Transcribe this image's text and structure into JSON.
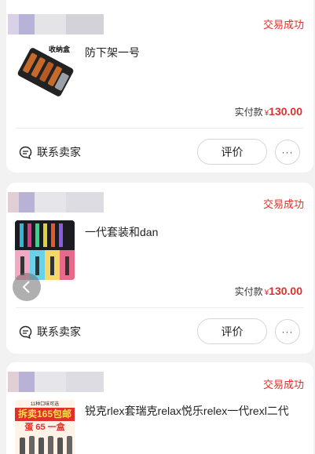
{
  "orders": [
    {
      "status": "交易成功",
      "thumb_badge": "收纳盒",
      "title": "防下架一号",
      "pay_label": "实付款",
      "currency": "¥",
      "amount": "130.00",
      "contact_label": "联系卖家",
      "review_label": "评价",
      "more_label": "···"
    },
    {
      "status": "交易成功",
      "title": "一代套装和dan",
      "pay_label": "实付款",
      "currency": "¥",
      "amount": "130.00",
      "contact_label": "联系卖家",
      "review_label": "评价",
      "more_label": "···"
    },
    {
      "status": "交易成功",
      "title": "锐克rlex套瑞克relax悦乐relex一代rexl二代",
      "thumb_text": {
        "top": "11种口味可选",
        "promo": "拆卖165包邮",
        "sub": "蛋 65 一盒"
      }
    }
  ],
  "icons": {
    "contact": "chat-bubble-icon",
    "back": "chevron-left-icon"
  },
  "colors": {
    "status_red": "#e0302b",
    "background": "#f2f2f2"
  }
}
